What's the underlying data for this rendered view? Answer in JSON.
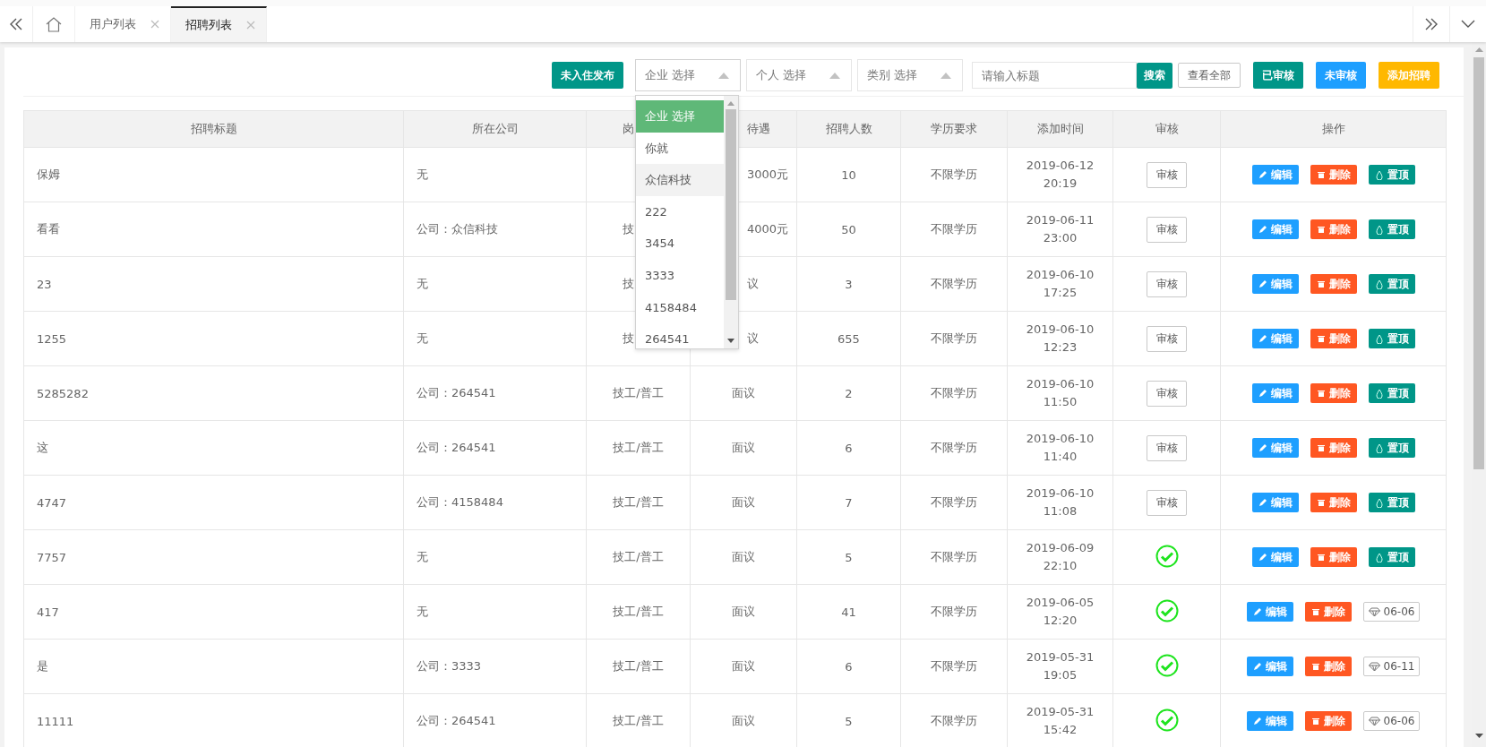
{
  "tabs": [
    {
      "label": "用户列表",
      "selected": false
    },
    {
      "label": "招聘列表",
      "selected": true
    }
  ],
  "toolbar": {
    "publish_button": "未入住发布",
    "selects": [
      {
        "placeholder": "企业 选择",
        "open": true
      },
      {
        "placeholder": "个人 选择",
        "open": false
      },
      {
        "placeholder": "类别 选择",
        "open": false
      }
    ],
    "search": {
      "placeholder": "请输入标题"
    },
    "search_button": "搜索",
    "view_all_button": "查看全部",
    "filter_buttons": [
      {
        "label": "已审核",
        "kind": "reviewed"
      },
      {
        "label": "未审核",
        "kind": "unreviewed"
      },
      {
        "label": "添加招聘",
        "kind": "add"
      }
    ]
  },
  "company_dropdown": {
    "options": [
      {
        "label": "企业 选择",
        "selected": true,
        "hovered": false
      },
      {
        "label": "你就",
        "selected": false,
        "hovered": false
      },
      {
        "label": "众信科技",
        "selected": false,
        "hovered": true
      },
      {
        "label": "222",
        "selected": false,
        "hovered": false
      },
      {
        "label": "3454",
        "selected": false,
        "hovered": false
      },
      {
        "label": "3333",
        "selected": false,
        "hovered": false
      },
      {
        "label": "4158484",
        "selected": false,
        "hovered": false
      },
      {
        "label": "264541",
        "selected": false,
        "hovered": false
      }
    ]
  },
  "table": {
    "columns": [
      "招聘标题",
      "所在公司",
      "岗",
      "待遇",
      "招聘人数",
      "学历要求",
      "添加时间",
      "审核",
      "操作"
    ],
    "rows": [
      {
        "title": "保姆",
        "company": "无",
        "salary": "3000元",
        "count": "10",
        "education": "不限学历",
        "date": "2019-06-12",
        "time": "20:19",
        "reviewed": false,
        "review_label": "审核",
        "edit": "编辑",
        "delete": "删除",
        "top": "置顶"
      },
      {
        "title": "看看",
        "company": "公司：众信科技",
        "position": "技",
        "salary": "4000元",
        "count": "50",
        "education": "不限学历",
        "date": "2019-06-11",
        "time": "23:00",
        "reviewed": false,
        "review_label": "审核",
        "edit": "编辑",
        "delete": "删除",
        "top": "置顶"
      },
      {
        "title": "23",
        "company": "无",
        "position": "技",
        "salary": "议",
        "count": "3",
        "education": "不限学历",
        "date": "2019-06-10",
        "time": "17:25",
        "reviewed": false,
        "review_label": "审核",
        "edit": "编辑",
        "delete": "删除",
        "top": "置顶"
      },
      {
        "title": "1255",
        "company": "无",
        "position": "技",
        "salary": "议",
        "count": "655",
        "education": "不限学历",
        "date": "2019-06-10",
        "time": "12:23",
        "reviewed": false,
        "review_label": "审核",
        "edit": "编辑",
        "delete": "删除",
        "top": "置顶"
      },
      {
        "title": "5285282",
        "company": "公司：264541",
        "position": "技工/普工",
        "salary": "面议",
        "count": "2",
        "education": "不限学历",
        "date": "2019-06-10",
        "time": "11:50",
        "reviewed": false,
        "review_label": "审核",
        "edit": "编辑",
        "delete": "删除",
        "top": "置顶"
      },
      {
        "title": "这",
        "company": "公司：264541",
        "position": "技工/普工",
        "salary": "面议",
        "count": "6",
        "education": "不限学历",
        "date": "2019-06-10",
        "time": "11:40",
        "reviewed": false,
        "review_label": "审核",
        "edit": "编辑",
        "delete": "删除",
        "top": "置顶"
      },
      {
        "title": "4747",
        "company": "公司：4158484",
        "position": "技工/普工",
        "salary": "面议",
        "count": "7",
        "education": "不限学历",
        "date": "2019-06-10",
        "time": "11:08",
        "reviewed": false,
        "review_label": "审核",
        "edit": "编辑",
        "delete": "删除",
        "top": "置顶"
      },
      {
        "title": "7757",
        "company": "无",
        "position": "技工/普工",
        "salary": "面议",
        "count": "5",
        "education": "不限学历",
        "date": "2019-06-09",
        "time": "22:10",
        "reviewed": true,
        "edit": "编辑",
        "delete": "删除",
        "top": "置顶"
      },
      {
        "title": "417",
        "company": "无",
        "position": "技工/普工",
        "salary": "面议",
        "count": "41",
        "education": "不限学历",
        "date": "2019-06-05",
        "time": "12:20",
        "reviewed": true,
        "edit": "编辑",
        "delete": "删除",
        "pinned": "06-06"
      },
      {
        "title": "是",
        "company": "公司：3333",
        "position": "技工/普工",
        "salary": "面议",
        "count": "6",
        "education": "不限学历",
        "date": "2019-05-31",
        "time": "19:05",
        "reviewed": true,
        "edit": "编辑",
        "delete": "删除",
        "pinned": "06-11"
      },
      {
        "title": "11111",
        "company": "公司：264541",
        "position": "技工/普工",
        "salary": "面议",
        "count": "5",
        "education": "不限学历",
        "date": "2019-05-31",
        "time": "15:42",
        "reviewed": true,
        "edit": "编辑",
        "delete": "删除",
        "pinned": "06-06"
      }
    ]
  }
}
